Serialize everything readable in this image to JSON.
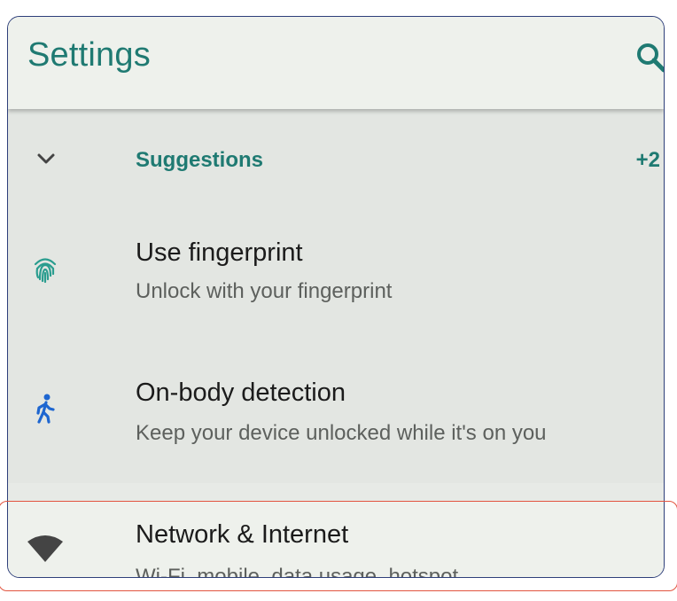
{
  "appbar": {
    "title": "Settings",
    "search_icon": "search-icon"
  },
  "suggestions": {
    "label": "Suggestions",
    "count": "+2",
    "chevron_icon": "chevron-down-icon",
    "items": [
      {
        "icon": "fingerprint-icon",
        "title": "Use fingerprint",
        "subtitle": "Unlock with your fingerprint"
      },
      {
        "icon": "walking-person-icon",
        "title": "On-body detection",
        "subtitle": "Keep your device unlocked while it's on you"
      }
    ]
  },
  "settings_items": [
    {
      "icon": "wifi-icon",
      "title": "Network & Internet",
      "subtitle": "Wi-Fi, mobile, data usage, hotspot"
    }
  ],
  "colors": {
    "accent": "#1f7a72",
    "highlight": "#e2543f",
    "frame": "#2e3f7a",
    "icon_blue": "#1e66d0",
    "icon_teal": "#2a9d8f"
  }
}
